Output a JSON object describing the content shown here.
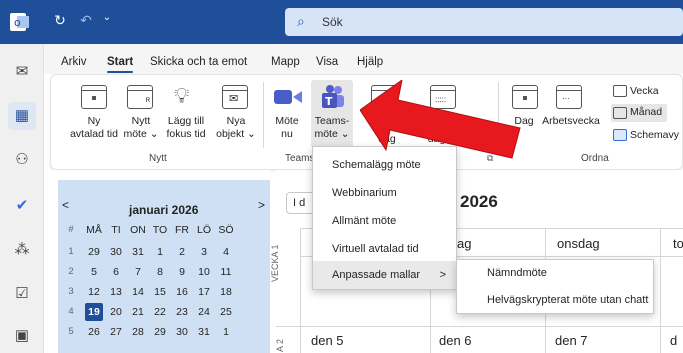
{
  "titlebar": {
    "search_placeholder": "Sök",
    "bg_color": "#1f4f99"
  },
  "ribbon_tabs": [
    "Arkiv",
    "Start",
    "Skicka och ta emot",
    "Mapp",
    "Visa",
    "Hjälp"
  ],
  "ribbon": {
    "new_group": {
      "label": "Nytt",
      "buttons": [
        {
          "line1": "Ny",
          "line2": "avtalad tid"
        },
        {
          "line1": "Nytt",
          "line2": "möte ⌄"
        },
        {
          "line1": "Lägg till",
          "line2": "fokus tid"
        },
        {
          "line1": "Nya",
          "line2": "objekt ⌄"
        }
      ]
    },
    "teams_group": {
      "label": "Teams",
      "buttons": [
        {
          "line1": "Möte",
          "line2": "nu"
        },
        {
          "line1": "Teams-",
          "line2": "möte ⌄"
        }
      ]
    },
    "go_group": {
      "labels": [
        "dag",
        "dagarna"
      ]
    },
    "arrange_group": {
      "label": "Ordna",
      "buttons": [
        "Dag",
        "Arbetsvecka"
      ],
      "small": [
        "Vecka",
        "Månad",
        "Schemavy"
      ]
    },
    "collapse_label": "⌄"
  },
  "menu": {
    "items": [
      "Schemalägg möte",
      "Webbinarium",
      "Allmänt möte",
      "Virtuell avtalad tid",
      "Anpassade mallar"
    ],
    "submenu_arrow": ">"
  },
  "submenu": {
    "items": [
      "Nämndmöte",
      "Helvägskrypterat möte utan chatt"
    ]
  },
  "minical": {
    "title": "januari 2026",
    "prev": "<",
    "next": ">",
    "headers": [
      "#",
      "MÅ",
      "TI",
      "ON",
      "TO",
      "FR",
      "LÖ",
      "SÖ"
    ],
    "weeks": [
      [
        "1",
        "29",
        "30",
        "31",
        "1",
        "2",
        "3",
        "4"
      ],
      [
        "2",
        "5",
        "6",
        "7",
        "8",
        "9",
        "10",
        "11"
      ],
      [
        "3",
        "12",
        "13",
        "14",
        "15",
        "16",
        "17",
        "18"
      ],
      [
        "4",
        "19",
        "20",
        "21",
        "22",
        "23",
        "24",
        "25"
      ],
      [
        "5",
        "26",
        "27",
        "28",
        "29",
        "30",
        "31",
        "1"
      ]
    ],
    "today": "19"
  },
  "calendar": {
    "title_year": "2026",
    "today_btn": "I d",
    "days": [
      "ag",
      "onsdag",
      "to"
    ],
    "week_labels": [
      "VECKA 1",
      "A 2"
    ],
    "dates": [
      "den 5",
      "den 6",
      "den 7",
      "d"
    ]
  },
  "accent_red": "#e8191e"
}
